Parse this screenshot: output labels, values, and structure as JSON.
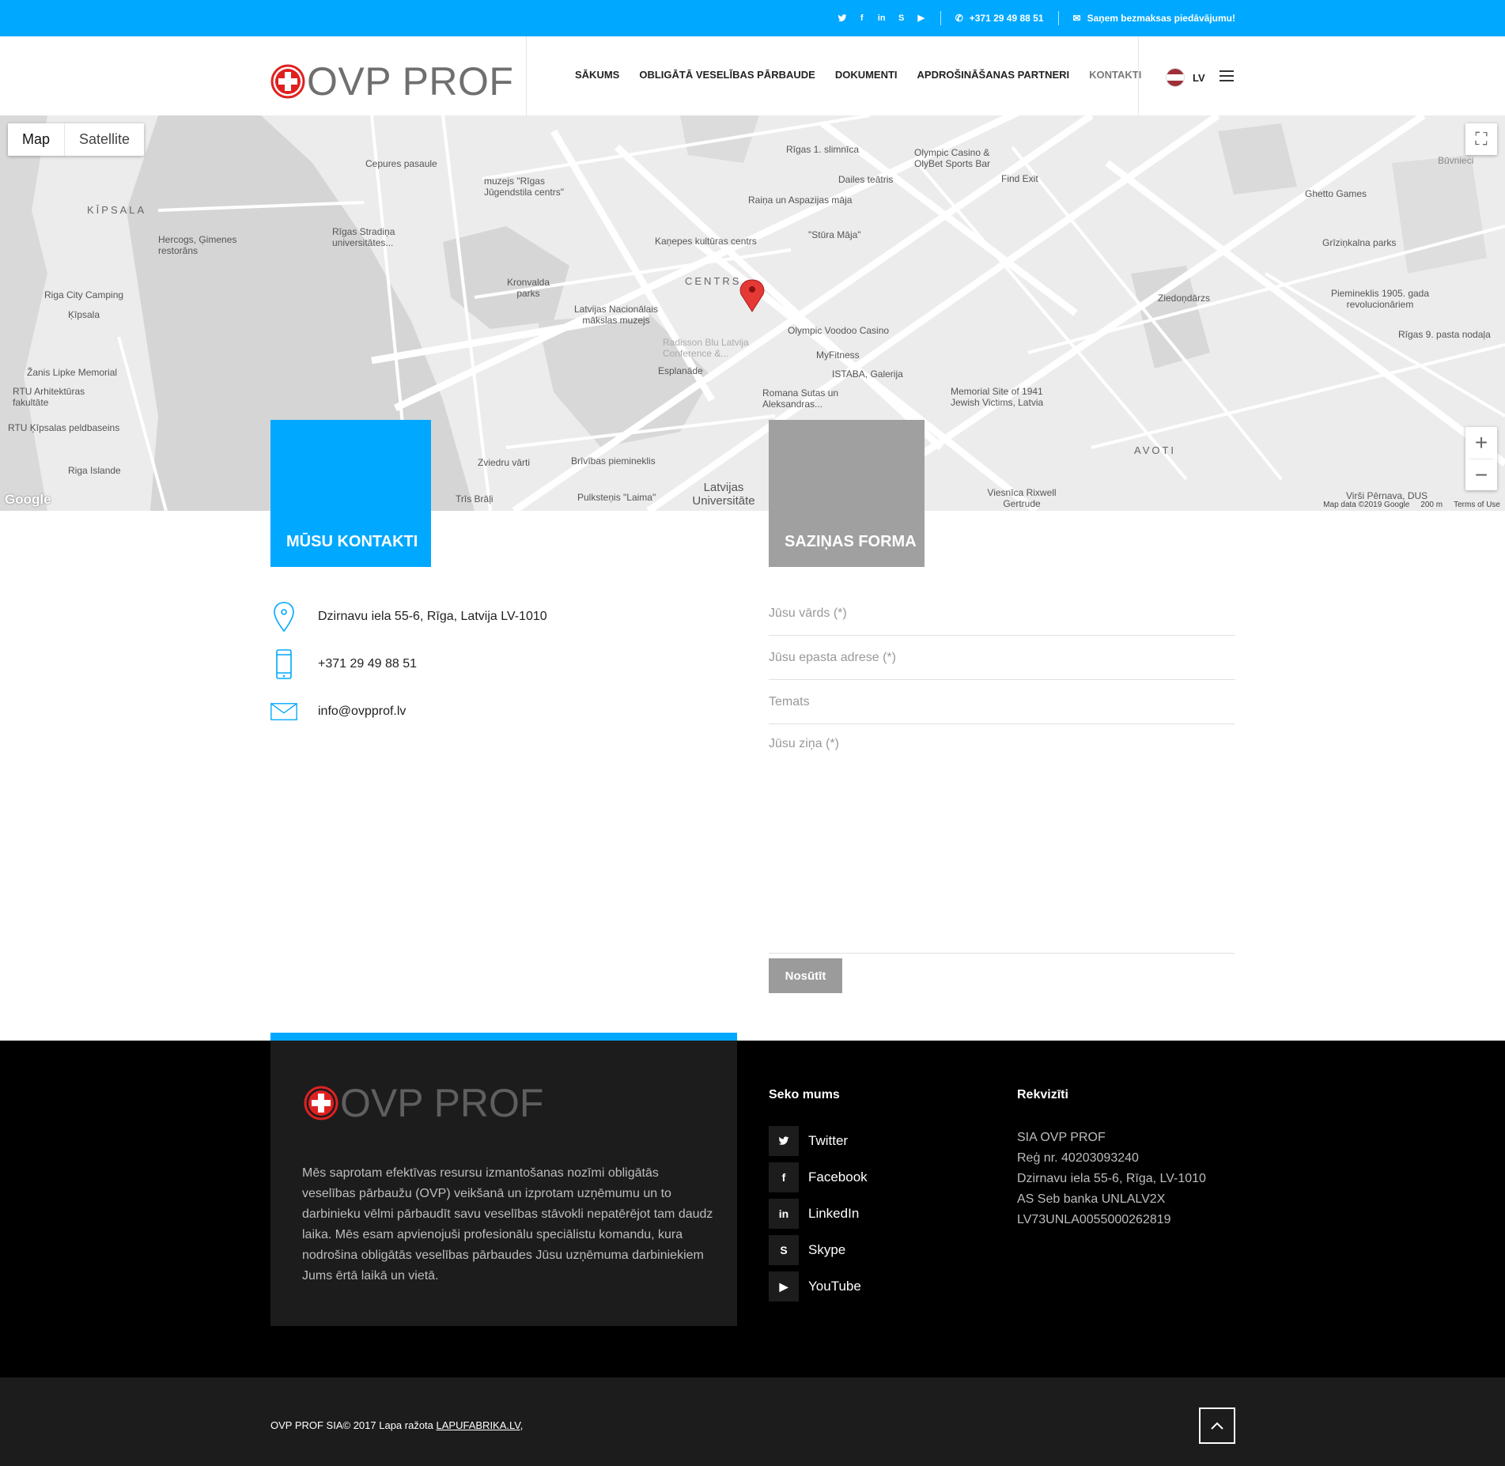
{
  "topbar": {
    "phone": "+371 29 49 88 51",
    "offer": "Saņem bezmaksas piedāvājumu!",
    "social_icons": [
      "twitter-icon",
      "facebook-icon",
      "linkedin-icon",
      "skype-icon",
      "youtube-icon"
    ]
  },
  "header": {
    "logo_text": "OVP PROF",
    "nav": [
      "SĀKUMS",
      "OBLIGĀTĀ VESELĪBAS PĀRBAUDE",
      "DOKUMENTI",
      "APDROŠINĀŠANAS PARTNERI",
      "KONTAKTI"
    ],
    "lang": "LV"
  },
  "map": {
    "type_buttons": [
      "Map",
      "Satellite"
    ],
    "attribution": "Map data ©2019 Google",
    "scale": "200 m",
    "terms": "Terms of Use",
    "google": "Google",
    "labels": {
      "cepures": "Cepures pasaule",
      "kipsala": "KĪPSALA",
      "camping": "Riga City Camping",
      "kipsala2": "Ķīpsala",
      "lipke": "Žanis Lipke Memorial",
      "rtu": "RTU Arhitektūras fakultāte",
      "peld": "RTU Ķīpsalas peldbaseins",
      "stradina": "Rīgas Stradiņa universitātes...",
      "hercogs": "Hercogs, Ģimenes restorāns",
      "jugend": "muzejs \"Rīgas Jūgendstila centrs\"",
      "kronvalda": "Kronvalda parks",
      "makslas": "Latvijas Nacionālais mākslas muzejs",
      "esplanade": "Esplanāde",
      "radisson": "Radisson Blu Latvija Conference &...",
      "centrs": "CENTRS",
      "kanepes": "Kaņepes kultūras centrs",
      "stura": "\"Stūra Māja\"",
      "raina": "Raiņa un Aspazijas māja",
      "dailes": "Dailes teātris",
      "slimnica": "Rīgas 1. slimnīca",
      "olympic": "Olympic Casino & OlyBet Sports Bar",
      "findexit": "Find Exit",
      "voodoo": "Olympic Voodoo Casino",
      "myfitness": "MyFitness",
      "istaba": "ISTABA, Galerija",
      "romana": "Romana Sutas un Aleksandras...",
      "memorial": "Memorial Site of 1941 Jewish Victims, Latvia",
      "ghetto": "Ghetto Games",
      "grizinkalna": "Grīziņkalna parks",
      "ziedond": "Ziedoņdārzs",
      "pieminek": "Piemineklis 1905. gada revolucionāriem",
      "pasta": "Rīgas 9. pasta nodaļa",
      "avoti": "AVOTI",
      "brivibas": "Brīvības piemineklis",
      "zviedru": "Zviedru vārti",
      "trisbrali": "Trīs Brāļi",
      "laima": "Pulksteņis \"Laima\"",
      "lu": "Latvijas Universitāte",
      "viesnica": "Viesnīca Rixwell Gertrude",
      "virsi": "Virši Pērnava, DUS",
      "riga_islande": "Riga Islande",
      "bvunieci": "Būvnieci"
    }
  },
  "contacts": {
    "title": "MŪSU KONTAKTI",
    "address": "Dzirnavu iela 55-6, Rīga, Latvija LV-1010",
    "phone": "+371 29 49 88 51",
    "email": "info@ovpprof.lv"
  },
  "form": {
    "title": "SAZIŅAS FORMA",
    "name_placeholder": "Jūsu vārds (*)",
    "email_placeholder": "Jūsu epasta adrese (*)",
    "subject_placeholder": "Temats",
    "message_placeholder": "Jūsu ziņa (*)",
    "submit": "Nosūtīt"
  },
  "footer": {
    "logo_text": "OVP PROF",
    "about": "Mēs saprotam efektīvas resursu izmantošanas nozīmi obligātās veselības pārbaužu (OVP) veikšanā un izprotam uzņēmumu un to darbinieku vēlmi pārbaudīt savu veselības stāvokli nepatērējot tam daudz laika. Mēs esam apvienojuši profesionālu speciālistu komandu, kura nodrošina obligātās veselības pārbaudes Jūsu uzņēmuma darbiniekiem Jums ērtā laikā un vietā.",
    "follow_title": "Seko mums",
    "social": [
      "Twitter",
      "Facebook",
      "LinkedIn",
      "Skype",
      "YouTube"
    ],
    "req_title": "Rekvizīti",
    "requisites": [
      "SIA OVP PROF",
      "Reģ nr. 40203093240",
      "Dzirnavu iela 55-6, Rīga, LV-1010",
      "AS Seb banka UNLALV2X",
      "LV73UNLA0055000262819"
    ],
    "copyright": "OVP PROF SIA© 2017 Lapa ražota",
    "maker": "LAPUFABRIKA.LV",
    "maker_suffix": ","
  },
  "colors": {
    "accent": "#00a8ff",
    "grey_box": "#a0a0a0",
    "footer": "#000000",
    "footer_box": "#1c1c1c",
    "map_pin": "#e53935",
    "flag_red": "#9e3039"
  }
}
